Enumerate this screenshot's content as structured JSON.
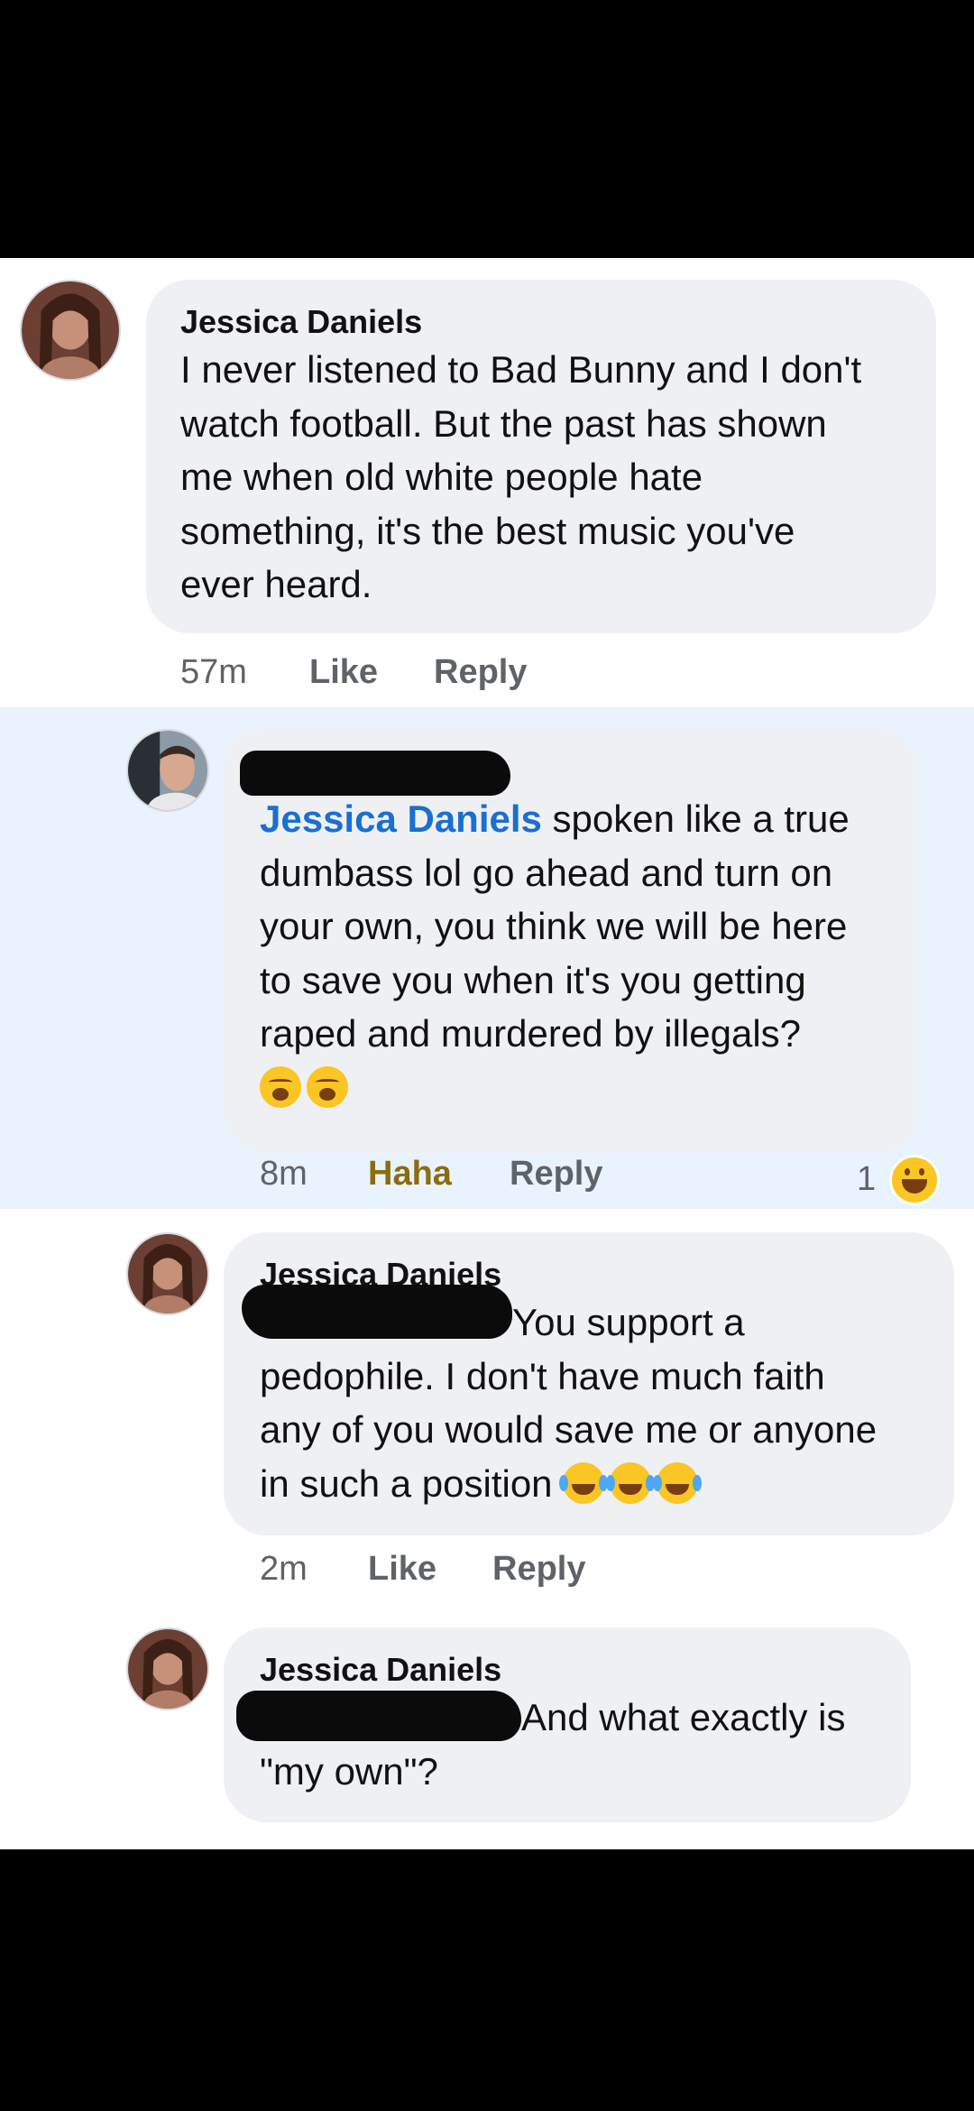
{
  "comments": [
    {
      "author": "Jessica Daniels",
      "text": "I never listened to Bad Bunny and I don't\nwatch football. But the past has shown\nme when old white people hate\nsomething, it's the best music you've\never heard.",
      "time": "57m",
      "like_label": "Like",
      "reply_label": "Reply"
    },
    {
      "author": "",
      "mention": "Jessica Daniels",
      "text": " spoken like a true\ndumbass lol go ahead and turn on\nyour own, you think we will be here\nto save you when it's you getting\nraped and murdered by illegals?",
      "emojis": [
        "yawning-face",
        "yawning-face"
      ],
      "time": "8m",
      "like_label": "Haha",
      "reply_label": "Reply",
      "reaction_count": "1",
      "reaction_icon": "grinning-squinting-face-icon"
    },
    {
      "author": "Jessica Daniels",
      "text": "You support a\npedophile. I don't have much faith\nany of you would save me or anyone\nin such a position",
      "emojis": [
        "face-with-tears-of-joy",
        "face-with-tears-of-joy",
        "face-with-tears-of-joy"
      ],
      "time": "2m",
      "like_label": "Like",
      "reply_label": "Reply"
    },
    {
      "author": "Jessica Daniels",
      "text": "And what exactly is\n\"my own\"?"
    }
  ],
  "colors": {
    "mention": "#1a6fd0",
    "bubble": "#eff0f4",
    "highlight": "#e8f3fd",
    "haha": "#8a6d10"
  }
}
